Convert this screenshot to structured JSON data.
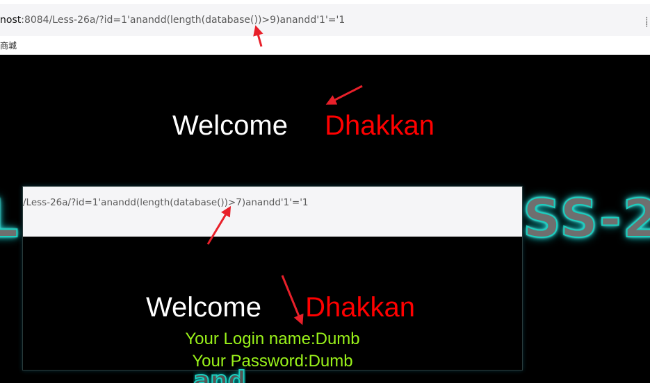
{
  "browser": {
    "url_host": "nost",
    "url_rest": ":8084/Less-26a/?id=1'anandd(length(database())>9)anandd'1'='1",
    "bookmark_label": "商城"
  },
  "page": {
    "welcome_text": "Welcome",
    "user_text": "Dhakkan",
    "logo_left": "L",
    "logo_right": "SS-2"
  },
  "inset": {
    "url_text": "/Less-26a/?id=1'anandd(length(database())>7)anandd'1'='1",
    "welcome_text": "Welcome",
    "user_text": "Dhakkan",
    "login_name_line": "Your Login name:Dumb",
    "password_line": "Your Password:Dumb"
  },
  "colors": {
    "annotation_arrow": "#e8202a",
    "welcome": "#ffffff",
    "user": "#ff0000",
    "login_info": "#9af21a"
  }
}
